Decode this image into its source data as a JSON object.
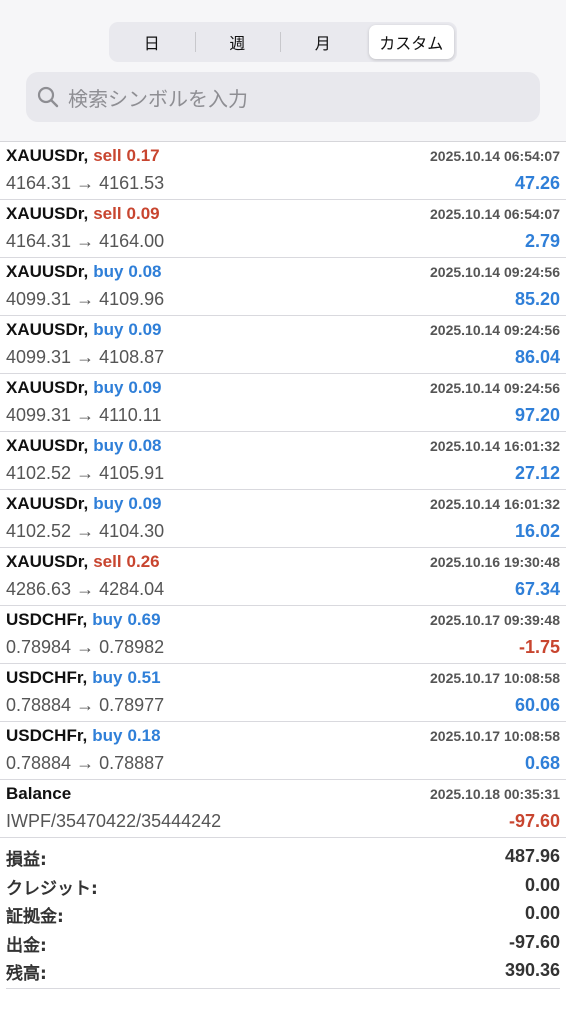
{
  "period_tabs": [
    {
      "label": "日",
      "active": false
    },
    {
      "label": "週",
      "active": false
    },
    {
      "label": "月",
      "active": false
    },
    {
      "label": "カスタム",
      "active": true
    }
  ],
  "search": {
    "placeholder": "検索シンボルを入力",
    "icon": "search-icon"
  },
  "colors": {
    "sell": "#c8452f",
    "buy": "#2f7fd8",
    "negative": "#c8452f",
    "positive": "#2f7fd8"
  },
  "deals": [
    {
      "symbol": "XAUUSDr,",
      "side": "sell",
      "volume": "0.17",
      "prices": "4164.31 → 4161.53",
      "time": "2025.10.14 06:54:07",
      "profit": "47.26",
      "profit_sign": "pos"
    },
    {
      "symbol": "XAUUSDr,",
      "side": "sell",
      "volume": "0.09",
      "prices": "4164.31 → 4164.00",
      "time": "2025.10.14 06:54:07",
      "profit": "2.79",
      "profit_sign": "pos"
    },
    {
      "symbol": "XAUUSDr,",
      "side": "buy",
      "volume": "0.08",
      "prices": "4099.31 → 4109.96",
      "time": "2025.10.14 09:24:56",
      "profit": "85.20",
      "profit_sign": "pos"
    },
    {
      "symbol": "XAUUSDr,",
      "side": "buy",
      "volume": "0.09",
      "prices": "4099.31 → 4108.87",
      "time": "2025.10.14 09:24:56",
      "profit": "86.04",
      "profit_sign": "pos"
    },
    {
      "symbol": "XAUUSDr,",
      "side": "buy",
      "volume": "0.09",
      "prices": "4099.31 → 4110.11",
      "time": "2025.10.14 09:24:56",
      "profit": "97.20",
      "profit_sign": "pos"
    },
    {
      "symbol": "XAUUSDr,",
      "side": "buy",
      "volume": "0.08",
      "prices": "4102.52 → 4105.91",
      "time": "2025.10.14 16:01:32",
      "profit": "27.12",
      "profit_sign": "pos"
    },
    {
      "symbol": "XAUUSDr,",
      "side": "buy",
      "volume": "0.09",
      "prices": "4102.52 → 4104.30",
      "time": "2025.10.14 16:01:32",
      "profit": "16.02",
      "profit_sign": "pos"
    },
    {
      "symbol": "XAUUSDr,",
      "side": "sell",
      "volume": "0.26",
      "prices": "4286.63 → 4284.04",
      "time": "2025.10.16 19:30:48",
      "profit": "67.34",
      "profit_sign": "pos"
    },
    {
      "symbol": "USDCHFr,",
      "side": "buy",
      "volume": "0.69",
      "prices": "0.78984 → 0.78982",
      "time": "2025.10.17 09:39:48",
      "profit": "-1.75",
      "profit_sign": "neg"
    },
    {
      "symbol": "USDCHFr,",
      "side": "buy",
      "volume": "0.51",
      "prices": "0.78884 → 0.78977",
      "time": "2025.10.17 10:08:58",
      "profit": "60.06",
      "profit_sign": "pos"
    },
    {
      "symbol": "USDCHFr,",
      "side": "buy",
      "volume": "0.18",
      "prices": "0.78884 → 0.78887",
      "time": "2025.10.17 10:08:58",
      "profit": "0.68",
      "profit_sign": "pos"
    },
    {
      "symbol": "Balance",
      "side": "",
      "volume": "",
      "prices": "IWPF/35470422/35444242",
      "time": "2025.10.18 00:35:31",
      "profit": "-97.60",
      "profit_sign": "neg"
    }
  ],
  "summary": [
    {
      "label": "損益:",
      "value": "487.96"
    },
    {
      "label": "クレジット:",
      "value": "0.00"
    },
    {
      "label": "証拠金:",
      "value": "0.00"
    },
    {
      "label": "出金:",
      "value": "-97.60"
    },
    {
      "label": "残高:",
      "value": "390.36"
    }
  ]
}
